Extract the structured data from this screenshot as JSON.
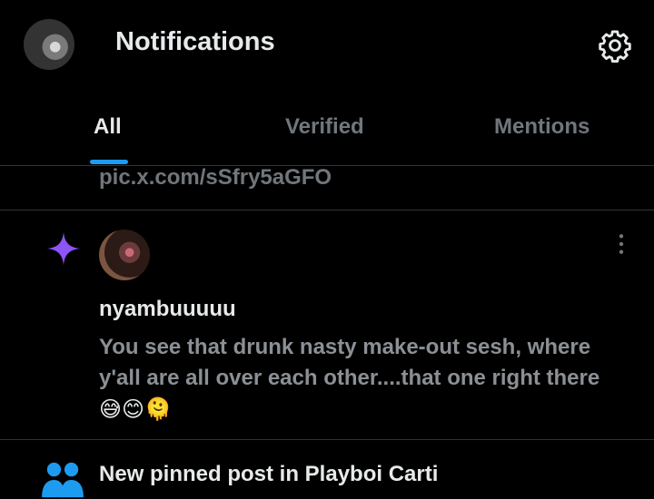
{
  "header": {
    "title": "Notifications",
    "settings_icon": "gear-icon"
  },
  "tabs": [
    {
      "label": "All",
      "active": true
    },
    {
      "label": "Verified",
      "active": false
    },
    {
      "label": "Mentions",
      "active": false
    }
  ],
  "colors": {
    "accent": "#1d9bf0",
    "sparkle": "#8d54f6",
    "people_icon": "#1d9bf0",
    "muted_text": "#71767b"
  },
  "notifications": [
    {
      "type": "text",
      "link": "pic.x.com/sSfry5aGFO"
    },
    {
      "type": "recommended",
      "icon": "sparkle-icon",
      "username": "nyambuuuuu",
      "text": "You see that drunk nasty make-out sesh, where y'all are all over each other....that one right there",
      "emojis": "😅😊🫠"
    },
    {
      "type": "pinned",
      "icon": "people-icon",
      "text": "New pinned post in Playboi Carti"
    }
  ]
}
